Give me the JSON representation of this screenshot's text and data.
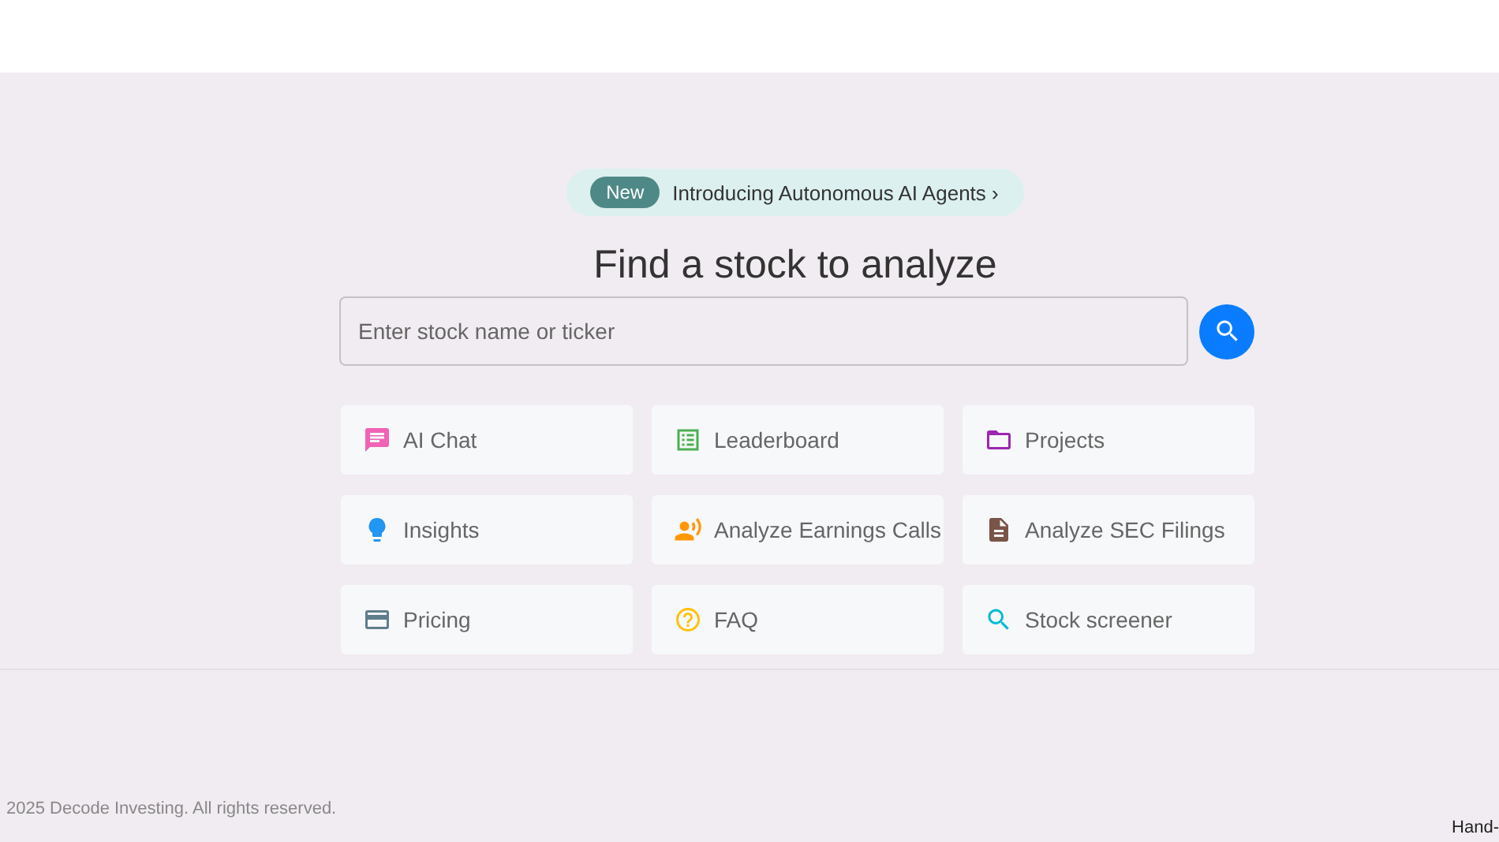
{
  "announcement": {
    "badge": "New",
    "text": "Introducing Autonomous AI Agents ›"
  },
  "heading": "Find a stock to analyze",
  "search": {
    "placeholder": "Enter stock name or ticker"
  },
  "tiles": [
    {
      "kind": "chat",
      "label": "AI Chat"
    },
    {
      "kind": "table",
      "label": "Leaderboard"
    },
    {
      "kind": "folder",
      "label": "Projects"
    },
    {
      "kind": "bulb",
      "label": "Insights"
    },
    {
      "kind": "speaker",
      "label": "Analyze Earnings Calls"
    },
    {
      "kind": "document",
      "label": "Analyze SEC Filings"
    },
    {
      "kind": "card",
      "label": "Pricing"
    },
    {
      "kind": "help",
      "label": "FAQ"
    },
    {
      "kind": "search",
      "label": "Stock screener"
    }
  ],
  "footer": {
    "copyright": "2025 Decode Investing. All rights reserved.",
    "corner_text": "Hand-"
  }
}
